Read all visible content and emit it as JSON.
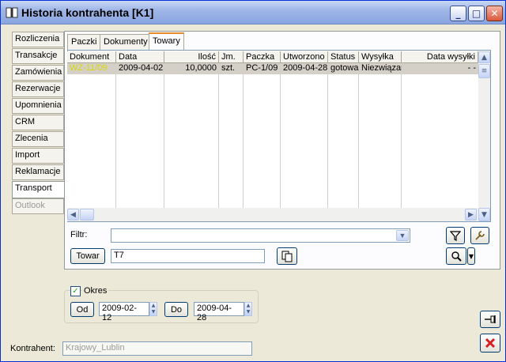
{
  "window": {
    "title": "Historia kontrahenta [K1]",
    "minimize": "_",
    "maximize": "□",
    "close": "✕"
  },
  "sidebar": {
    "items": [
      {
        "label": "Rozliczenia"
      },
      {
        "label": "Transakcje"
      },
      {
        "label": "Zamówienia"
      },
      {
        "label": "Rezerwacje"
      },
      {
        "label": "Upomnienia"
      },
      {
        "label": "CRM"
      },
      {
        "label": "Zlecenia"
      },
      {
        "label": "Import"
      },
      {
        "label": "Reklamacje"
      },
      {
        "label": "Transport"
      },
      {
        "label": "Outlook"
      }
    ],
    "active": "Transport"
  },
  "tabs": [
    {
      "label": "Paczki"
    },
    {
      "label": "Dokumenty"
    },
    {
      "label": "Towary"
    }
  ],
  "grid": {
    "columns": [
      "Dokument",
      "Data",
      "Ilość",
      "Jm.",
      "Paczka",
      "Utworzono",
      "Status",
      "Wysyłka",
      "Data wysyłki"
    ],
    "rows": [
      [
        "WZ-11/09",
        "2009-04-02",
        "10,0000",
        "szt.",
        "PC-1/09",
        "2009-04-28",
        "gotowa",
        "Niezwiązan",
        "- -"
      ]
    ]
  },
  "filter": {
    "label": "Filtr:",
    "value": ""
  },
  "towar": {
    "button": "Towar",
    "value": "T7"
  },
  "period": {
    "checkbox_label": "Okres",
    "checked": true,
    "from_button": "Od",
    "from_value": "2009-02-12",
    "to_button": "Do",
    "to_value": "2009-04-28"
  },
  "contractor": {
    "label": "Kontrahent:",
    "value": "Krajowy_Lublin"
  },
  "colors": {
    "accent": "#e68b2c",
    "row_highlight": "#d4d0c8",
    "doc_link": "#d8d800"
  }
}
